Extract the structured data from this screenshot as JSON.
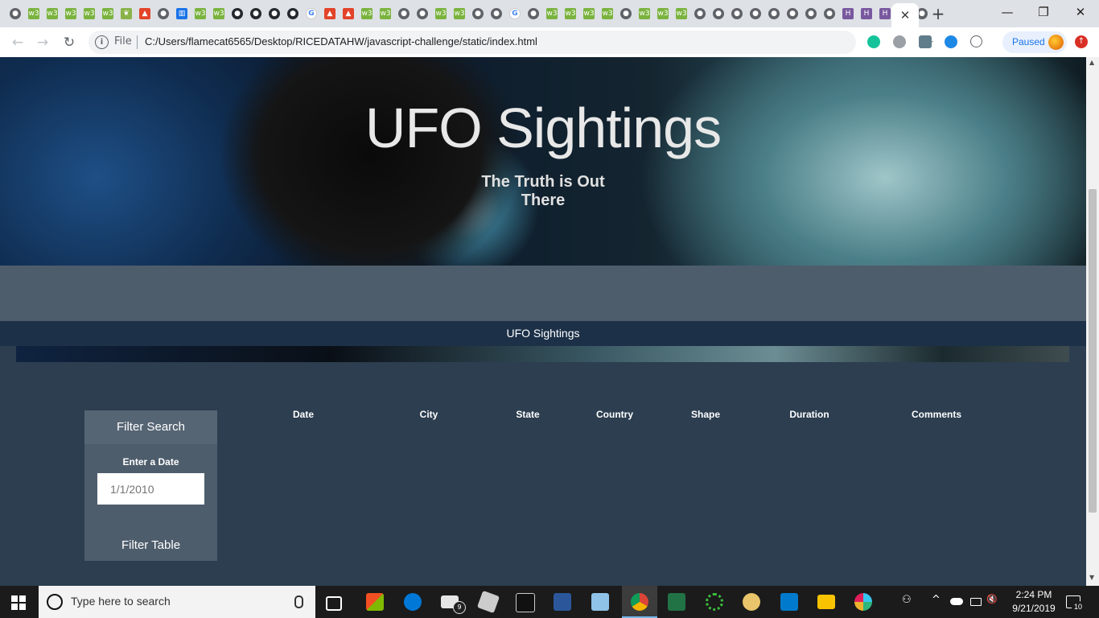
{
  "browser": {
    "favicons": [
      "globe",
      "w3",
      "w3",
      "w3",
      "w3",
      "w3",
      "leaf",
      "fox",
      "globe",
      "chart",
      "w3",
      "w3",
      "git",
      "git",
      "git",
      "git",
      "goog",
      "fox",
      "fox",
      "w3",
      "w3",
      "globe",
      "globe",
      "w3",
      "w3",
      "globe",
      "globe",
      "goog",
      "globe",
      "w3",
      "w3",
      "w3",
      "w3",
      "globe",
      "w3",
      "w3",
      "w3",
      "globe",
      "globe",
      "globe",
      "globe",
      "globe",
      "globe",
      "globe",
      "globe",
      "her",
      "her",
      "her",
      "git",
      "globe"
    ],
    "active_tab_close": "✕",
    "new_tab": "+",
    "window_controls": {
      "minimize": "—",
      "maximize": "❐",
      "close": "✕"
    },
    "nav": {
      "back": "←",
      "forward": "→",
      "reload": "↻"
    },
    "address": {
      "info": "i",
      "scheme": "File",
      "url": "C:/Users/flamecat6565/Desktop/RICEDATAHW/javascript-challenge/static/index.html"
    },
    "bookmark_star": "☆",
    "profile": {
      "label": "Paused"
    },
    "update_glyph": "↑"
  },
  "page": {
    "jumbotron": {
      "title": "UFO Sightings",
      "subtitle": "The Truth is Out There"
    },
    "navbar": {
      "title": "UFO Sightings"
    },
    "filter": {
      "heading": "Filter Search",
      "date_label": "Enter a Date",
      "date_placeholder": "1/1/2010",
      "button_label": "Filter Table"
    },
    "table": {
      "headers": [
        "Date",
        "City",
        "State",
        "Country",
        "Shape",
        "Duration",
        "Comments"
      ]
    }
  },
  "taskbar": {
    "search_placeholder": "Type here to search",
    "mail_badge": "9",
    "tray_chevron": "^",
    "tray_people": "⚇",
    "tray_volume": "🔇",
    "clock": {
      "time": "2:24 PM",
      "date": "9/21/2019"
    },
    "notifications": "10"
  },
  "colors": {
    "accent": "#1a73e8",
    "page_bg": "#2c3e50",
    "panel": "#4e5d6c",
    "navbar": "#1c3048"
  }
}
